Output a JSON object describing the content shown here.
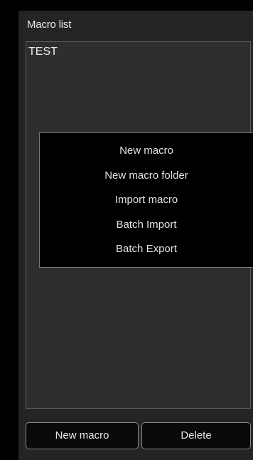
{
  "panel": {
    "title": "Macro list"
  },
  "macros": [
    {
      "name": "TEST"
    }
  ],
  "context_menu": {
    "items": [
      {
        "label": "New macro"
      },
      {
        "label": "New macro folder"
      },
      {
        "label": "Import macro"
      },
      {
        "label": "Batch Import"
      },
      {
        "label": "Batch Export"
      }
    ]
  },
  "buttons": {
    "new_macro": "New macro",
    "delete": "Delete"
  }
}
